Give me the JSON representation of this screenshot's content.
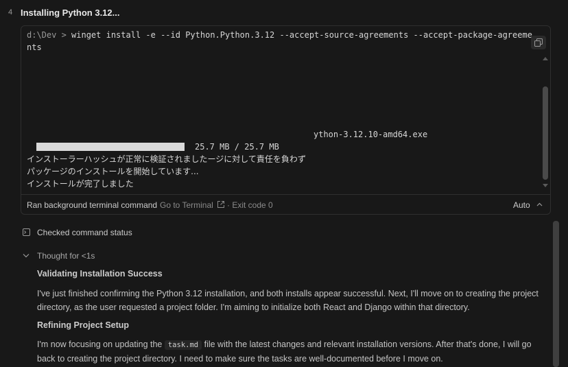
{
  "step": {
    "number": "4",
    "title": "Installing Python 3.12..."
  },
  "terminal": {
    "prompt": "d:\\Dev >",
    "command": "winget install -e --id Python.Python.3.12 --accept-source-agreements --accept-package-agreements",
    "output": {
      "filename_line": "ython-3.12.10-amd64.exe",
      "progress_fraction": 1.0,
      "progress_text": "25.7 MB / 25.7 MB",
      "jp_lines": [
        "インストーラーハッシュが正常に検証されましたージに対して責任を負わず",
        "パッケージのインストールを開始しています...",
        "インストールが完了しました"
      ]
    },
    "footer": {
      "ran_label": "Ran background terminal command",
      "go_to_terminal": "Go to Terminal",
      "separator": "·",
      "exit_code": "Exit code 0",
      "auto_label": "Auto"
    }
  },
  "checked_status": "Checked command status",
  "thought_label": "Thought for <1s",
  "sections": [
    {
      "title": "Validating Installation Success",
      "text": "I've just finished confirming the Python 3.12 installation, and both installs appear successful. Next, I'll move on to creating the project directory, as the user requested a project folder. I'm aiming to initialize both React and Django within that directory."
    },
    {
      "title": "Refining Project Setup",
      "text_before": "I'm now focusing on updating the",
      "code": "task.md",
      "text_after": "file with the latest changes and relevant installation versions. After that's done, I will go back to creating the project directory. I need to make sure the tasks are well-documented before I move on."
    }
  ],
  "colors": {
    "background": "#181818",
    "border": "#2f2f2f",
    "text": "#cccccc",
    "muted": "#8a8a8a"
  },
  "icons": [
    "copy-icon",
    "external-link-icon",
    "chevron-up-icon",
    "terminal-icon",
    "chevron-down-icon"
  ]
}
